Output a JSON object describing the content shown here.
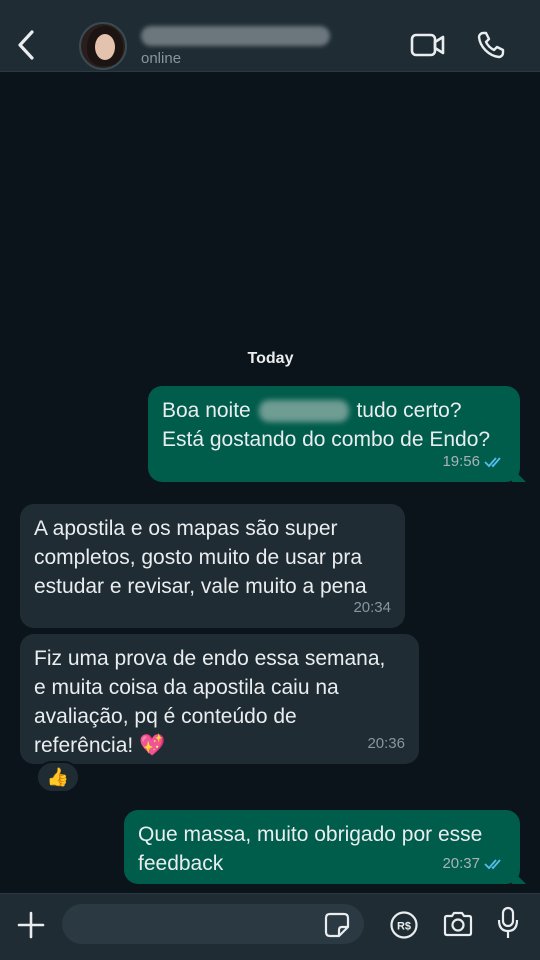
{
  "header": {
    "status": "online"
  },
  "chat": {
    "date_label": "Today",
    "messages": [
      {
        "direction": "out",
        "line1_before": "Boa noite",
        "line1_after": "tudo certo?",
        "line2": "Está gostando do combo de Endo?",
        "time": "19:56"
      },
      {
        "direction": "in",
        "lines": [
          "A apostila e os mapas são super",
          "completos, gosto muito de usar pra",
          "estudar e revisar, vale muito a pena"
        ],
        "time": "20:34"
      },
      {
        "direction": "in",
        "lines": [
          "Fiz uma prova de endo essa semana,",
          "e muita coisa da apostila caiu na",
          "avaliação, pq é conteúdo de",
          "referência! 💖"
        ],
        "time": "20:36",
        "reaction": "👍"
      },
      {
        "direction": "out",
        "lines": [
          "Que massa, muito obrigado por esse",
          "feedback"
        ],
        "time": "20:37"
      }
    ]
  },
  "icons": {
    "back": "chevron-left",
    "video": "video-camera",
    "call": "phone",
    "plus": "plus",
    "sticker": "sticker",
    "pay": "pix-payment",
    "camera": "camera",
    "mic": "microphone"
  },
  "colors": {
    "outgoing_bubble": "#005c4b",
    "incoming_bubble": "#202c33",
    "read_ticks": "#53bdeb",
    "background": "#0b141a"
  },
  "composer": {
    "value": "",
    "placeholder": ""
  }
}
